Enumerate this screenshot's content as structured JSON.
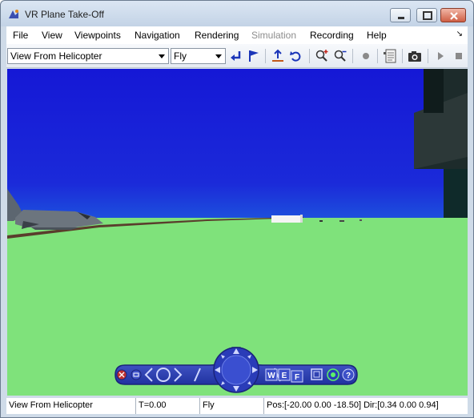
{
  "window": {
    "title": "VR Plane Take-Off"
  },
  "menu": [
    "File",
    "View",
    "Viewpoints",
    "Navigation",
    "Rendering",
    "Simulation",
    "Recording",
    "Help"
  ],
  "menu_disabled": "Simulation",
  "toolbar": {
    "viewpoint_select": "View From Helicopter",
    "navigation_mode_select": "Fly"
  },
  "nav_panel": {
    "buttons": [
      "W",
      "E",
      "F"
    ]
  },
  "status": {
    "viewpoint": "View From Helicopter",
    "time": "T=0.00",
    "mode": "Fly",
    "position": "Pos:[-20.00 0.00 -18.50] Dir:[0.34 0.00 0.94]"
  }
}
